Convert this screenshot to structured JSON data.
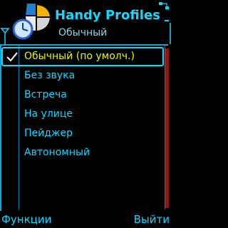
{
  "app": {
    "title": "Handy Profiles",
    "subtitle": "Обычный"
  },
  "profiles": [
    {
      "label": "Обычный (по умолч.)",
      "selected": true,
      "checked": true
    },
    {
      "label": "Без звука",
      "selected": false,
      "checked": false
    },
    {
      "label": "Встреча",
      "selected": false,
      "checked": false
    },
    {
      "label": "На улице",
      "selected": false,
      "checked": false
    },
    {
      "label": "Пейджер",
      "selected": false,
      "checked": false
    },
    {
      "label": "Автономный",
      "selected": false,
      "checked": false
    }
  ],
  "softkeys": {
    "left": "Функции",
    "right": "Выйти"
  },
  "icons": {
    "app": "handy-profiles-app-icon",
    "signal": "signal-strength-icon",
    "battery": "battery-level-icon",
    "sync": "connectivity-icon",
    "check": "checkmark-icon"
  },
  "colors": {
    "accent": "#12d6ff",
    "selected_text": "#e8f700",
    "scroll_thumb": "#8a1a1a",
    "background": "#000000"
  }
}
